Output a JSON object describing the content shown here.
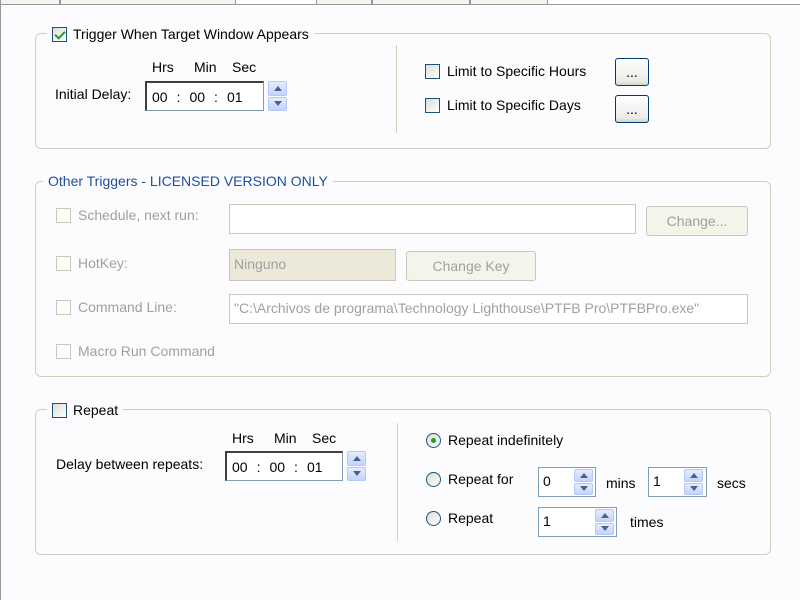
{
  "window_trigger": {
    "enabled": true,
    "legend": "Trigger When Target Window Appears",
    "initial_delay_label": "Initial Delay:",
    "hrs_label": "Hrs",
    "min_label": "Min",
    "sec_label": "Sec",
    "hrs": "00",
    "min": "00",
    "sec": "01",
    "sep": ":",
    "limit_hours": {
      "label": "Limit to Specific Hours",
      "checked": false,
      "button": "..."
    },
    "limit_days": {
      "label": "Limit to Specific Days",
      "checked": false,
      "button": "..."
    }
  },
  "other_triggers": {
    "legend": "Other Triggers - LICENSED VERSION ONLY",
    "schedule": {
      "label": "Schedule, next run:",
      "value": "",
      "button": "Change..."
    },
    "hotkey": {
      "label": "HotKey:",
      "value": "Ninguno",
      "button": "Change Key"
    },
    "command_line": {
      "label": "Command Line:",
      "value": "\"C:\\Archivos de programa\\Technology Lighthouse\\PTFB Pro\\PTFBPro.exe\""
    },
    "macro_run": {
      "label": "Macro Run Command"
    }
  },
  "repeat": {
    "legend": "Repeat",
    "enabled": false,
    "delay_label": "Delay between repeats:",
    "hrs_label": "Hrs",
    "min_label": "Min",
    "sec_label": "Sec",
    "hrs": "00",
    "min": "00",
    "sec": "01",
    "sep": ":",
    "indefinitely_label": "Repeat indefinitely",
    "repeat_for_label": "Repeat for",
    "mins_value": "0",
    "mins_label": "mins",
    "secs_value": "1",
    "secs_label": "secs",
    "repeat_label": "Repeat",
    "times_value": "1",
    "times_label": "times",
    "selected_mode": "indefinitely"
  },
  "colors": {
    "accent_blue": "#1e4f9c",
    "check_green": "#21a121",
    "group_border": "#d0d0bf"
  }
}
